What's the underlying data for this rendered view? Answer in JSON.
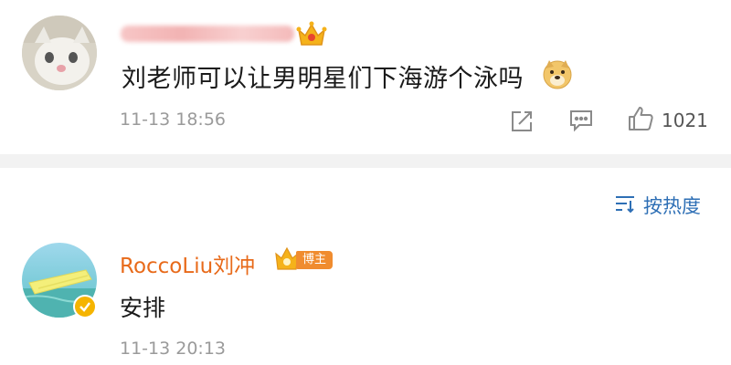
{
  "comment1": {
    "text": "刘老师可以让男明星们下海游个泳吗",
    "timestamp": "11-13 18:56",
    "like_count": "1021",
    "avatar_icon": "cat-avatar",
    "badge_icon": "crown-icon",
    "emoji_icon": "doge-emoji-icon"
  },
  "sort": {
    "label": "按热度",
    "icon": "sort-icon"
  },
  "comment2": {
    "author": "RoccoLiu刘冲",
    "badge_label": "博主",
    "text": "安排",
    "timestamp": "11-13 20:13",
    "avatar_icon": "pool-float-avatar",
    "verified_icon": "verified-badge-icon"
  },
  "colors": {
    "author_name": "#e86a1a",
    "sort_link": "#2e6fb5",
    "blogger_badge": "#f08c2f",
    "muted_text": "#9a9a9a",
    "divider": "#f2f2f2"
  }
}
